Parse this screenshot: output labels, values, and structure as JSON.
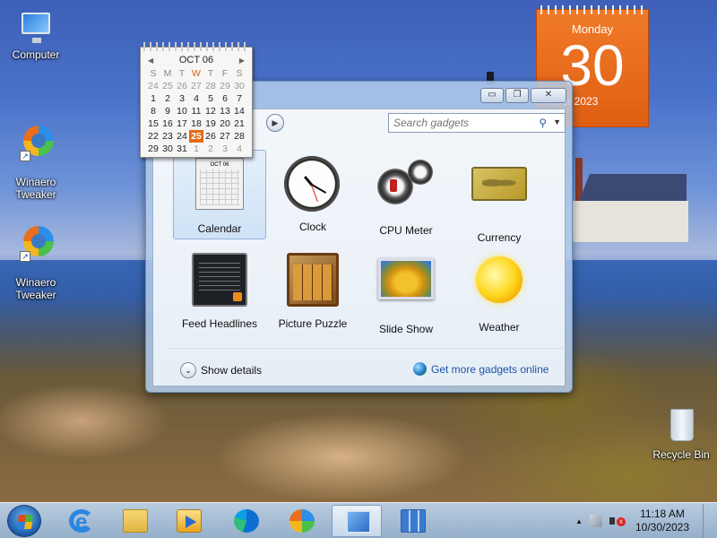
{
  "desktop": {
    "icons": [
      {
        "label": "Computer"
      },
      {
        "label": "Winaero\nTweaker"
      },
      {
        "label": "Winaero\nTweaker"
      },
      {
        "label": "Recycle Bin"
      }
    ]
  },
  "calendar_gadget": {
    "weekday": "Monday",
    "day": "30",
    "month_year": "October 2023"
  },
  "mini_calendar": {
    "month_label": "OCT 06",
    "prev_arrow": "◀",
    "next_arrow": "▶",
    "weekdays": [
      "S",
      "M",
      "T",
      "W",
      "T",
      "F",
      "S"
    ],
    "today_column_index": 3,
    "weeks": [
      [
        "24",
        "25",
        "26",
        "27",
        "28",
        "29",
        "30"
      ],
      [
        "1",
        "2",
        "3",
        "4",
        "5",
        "6",
        "7"
      ],
      [
        "8",
        "9",
        "10",
        "11",
        "12",
        "13",
        "14"
      ],
      [
        "15",
        "16",
        "17",
        "18",
        "19",
        "20",
        "21"
      ],
      [
        "22",
        "23",
        "24",
        "25",
        "26",
        "27",
        "28"
      ],
      [
        "29",
        "30",
        "31",
        "1",
        "2",
        "3",
        "4"
      ]
    ],
    "selected_day": "25"
  },
  "gadget_window": {
    "search_placeholder": "Search gadgets",
    "search_icon": "search-icon",
    "minimize": "▭",
    "restore": "❐",
    "close": "✕",
    "nav": "▶",
    "gadgets": [
      {
        "label": "Calendar"
      },
      {
        "label": "Clock"
      },
      {
        "label": "CPU Meter"
      },
      {
        "label": "Currency"
      },
      {
        "label": "Feed Headlines"
      },
      {
        "label": "Picture Puzzle"
      },
      {
        "label": "Slide Show"
      },
      {
        "label": "Weather"
      }
    ],
    "show_details": "Show details",
    "show_details_chevron": "⌄",
    "get_more": "Get more gadgets online"
  },
  "taskbar": {
    "apps": [
      "Internet Explorer",
      "File Explorer",
      "Windows Media Player",
      "Microsoft Edge",
      "Winaero Tweaker",
      "Gadgets",
      "Control Panel"
    ],
    "tray_up": "▲",
    "time": "11:18 AM",
    "date": "10/30/2023"
  },
  "colors": {
    "calendar_orange": "#e8681a",
    "link_blue": "#1a54a6"
  }
}
